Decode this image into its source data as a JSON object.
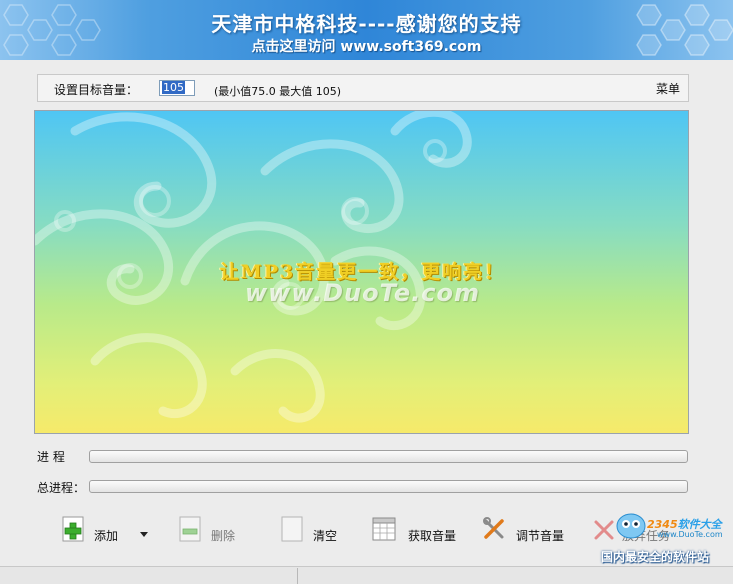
{
  "banner": {
    "title": "天津市中格科技----感谢您的支持",
    "link": "点击这里访问 www.soft369.com"
  },
  "settings": {
    "label": "设置目标音量：",
    "volume_value": "105",
    "range_text": "(最小值75.0    最大值 105)",
    "menu_label": "菜单"
  },
  "panel": {
    "slogan": "让MP3音量更一致，更响亮！",
    "watermark": "www.DuoTe.com"
  },
  "progress": {
    "current_label": "进    程",
    "current_value": 0,
    "total_label": "总进程：",
    "total_value": 0
  },
  "toolbar": {
    "add_label": "添加",
    "delete_label": "删除",
    "clear_label": "清空",
    "get_volume_label": "获取音量",
    "adjust_volume_label": "调节音量",
    "abort_label": "放弃任务"
  },
  "logo": {
    "brand_num": "2345",
    "brand_text": "软件大全",
    "url": "www.DuoTe.com",
    "safe_text": "国内最安全的软件站"
  },
  "colors": {
    "banner_blue": "#2f86d8",
    "slogan_yellow": "#f0cf25",
    "add_green": "#3cae2e"
  }
}
